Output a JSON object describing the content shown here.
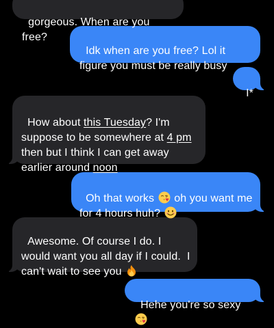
{
  "conversation": {
    "messages": [
      {
        "direction": "incoming",
        "segments": [
          {
            "text": "gorgeous. When are you free?"
          }
        ]
      },
      {
        "direction": "outgoing",
        "segments": [
          {
            "text": "Idk when are you free? Lol it figure you must be really busy"
          }
        ]
      },
      {
        "direction": "outgoing",
        "segments": [
          {
            "text": "I*"
          }
        ]
      },
      {
        "direction": "incoming",
        "segments": [
          {
            "text": "How about "
          },
          {
            "text": "this Tuesday",
            "link": true
          },
          {
            "text": "? I'm suppose to be somewhere at "
          },
          {
            "text": "4 pm",
            "link": true
          },
          {
            "text": " then but I think I can get away earlier around "
          },
          {
            "text": "noon",
            "link": true
          }
        ]
      },
      {
        "direction": "outgoing",
        "segments": [
          {
            "text": "Oh that works "
          },
          {
            "emoji": "face-blowing-kiss-emoji"
          },
          {
            "text": " oh you want me for 4 hours huh? "
          },
          {
            "emoji": "smiling-face-emoji"
          }
        ]
      },
      {
        "direction": "incoming",
        "segments": [
          {
            "text": "Awesome. Of course I do. I would want you all day if I could.  I can't wait to see you "
          },
          {
            "emoji": "fire-emoji"
          }
        ]
      },
      {
        "direction": "outgoing",
        "segments": [
          {
            "text": "Hehe you're so sexy "
          },
          {
            "emoji": "face-blowing-kiss-emoji"
          }
        ]
      }
    ]
  },
  "colors": {
    "background": "#000000",
    "incoming_bubble": "#262629",
    "outgoing_bubble": "#3a86f7",
    "text": "#ffffff"
  }
}
